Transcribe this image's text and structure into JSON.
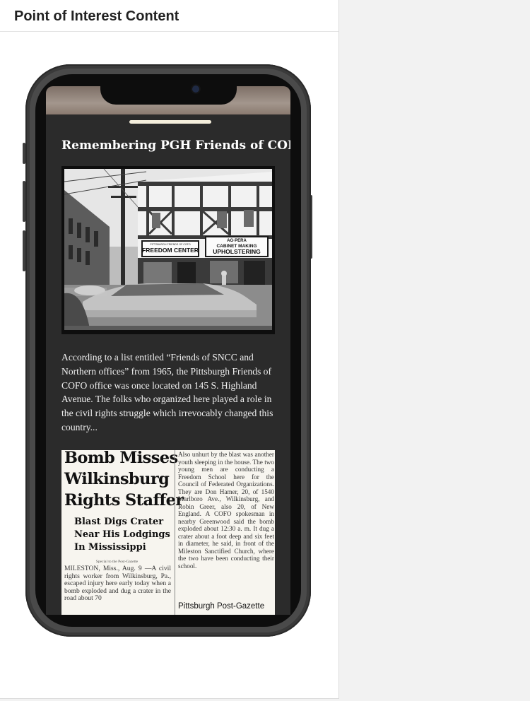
{
  "panel": {
    "title": "Point of Interest Content"
  },
  "poi": {
    "title": "Remembering PGH Friends of COFO",
    "photo": {
      "signs": {
        "freedom_center": "FREEDOM CENTER",
        "small_sign": "PITTSBURGH FRIENDS OF COFO",
        "agpera": "AG·PERA",
        "cabinet": "CABINET MAKING",
        "upholstering": "UPHOLSTERING"
      }
    },
    "description": "According to a list entitled “Friends of SNCC and Northern offices” from 1965,  the Pittsburgh Friends of COFO office was once located on 145 S. Highland Avenue. The folks who organized here played a role in the civil rights struggle which irrevocably changed this country...",
    "clipping": {
      "headline_lines": [
        "Bomb Misses",
        "Wilkinsburg",
        "Rights Staffer"
      ],
      "subhead_lines": [
        "Blast Digs Crater",
        "Near His Lodgings",
        "In Mississippi"
      ],
      "special_line": "Special to the Post-Gazette",
      "left_body": "MILESTON, Miss., Aug. 9 —A civil rights worker from Wilkinsburg, Pa., escaped injury here early today when a bomb exploded and dug a crater in the road about 70",
      "right_body": "Also unhurt by the blast was another youth sleeping in the house. The two young men are conducting a Freedom School here for the Council of Federated Organizations. They are Don Hamer, 20, of 1540 Marlboro Ave., Wilkinsburg, and Robin Greer, also 20, of New England. A COFO spokesman in nearby Greenwood said the bomb exploded about 12:30 a. m. It dug a crater about a foot deep and six feet in diameter, he said, in front of the Mileston Sanctified Church, where the two have been conducting their school.",
      "source_label": "Pittsburgh Post-Gazette"
    }
  },
  "colors": {
    "screen_bg": "#2b2b2b",
    "phone_frame": "#4a4a4a",
    "handle": "#f4eedc"
  }
}
